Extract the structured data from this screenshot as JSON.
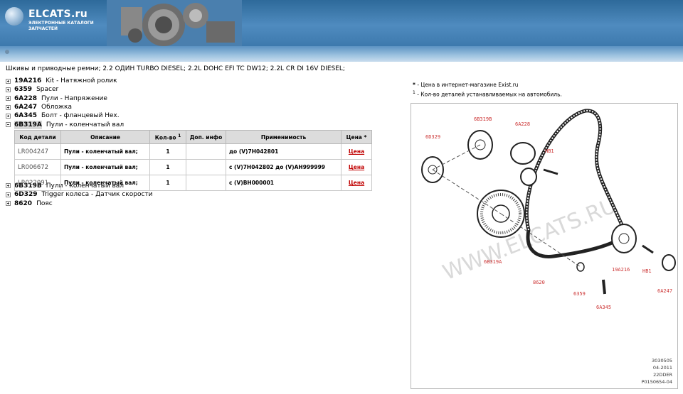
{
  "header": {
    "logo_text": "ELCATS.ru",
    "logo_sub1": "ЭЛЕКТРОННЫЕ КАТАЛОГИ",
    "logo_sub2": "ЗАПЧАСТЕЙ"
  },
  "page_title": "Шкивы и приводные ремни; 2.2 ОДИН TURBO DIESEL; 2.2L DOHC EFI TC DW12; 2.2L CR DI 16V DIESEL;",
  "tree": [
    {
      "code": "19A216",
      "label": "Kit - Натяжной ролик",
      "state": "collapsed"
    },
    {
      "code": "6359",
      "label": "Spacer",
      "state": "collapsed"
    },
    {
      "code": "6A228",
      "label": "Пули - Напряжение",
      "state": "collapsed"
    },
    {
      "code": "6A247",
      "label": "Обложка",
      "state": "collapsed"
    },
    {
      "code": "6A345",
      "label": "Болт - фланцевый Hex.",
      "state": "collapsed"
    },
    {
      "code": "6B319A",
      "label": "Пули - коленчатый вал",
      "state": "expanded"
    },
    {
      "code": "6B319B",
      "label": "Пули - коленчатый вал",
      "state": "collapsed"
    },
    {
      "code": "6D329",
      "label": "Trigger колеса - Датчик скорости",
      "state": "collapsed"
    },
    {
      "code": "8620",
      "label": "Пояс",
      "state": "collapsed"
    }
  ],
  "table": {
    "headers": {
      "part_no": "Код детали",
      "desc": "Описание",
      "qty": "Кол-во",
      "qty_sup": "1",
      "extra": "Доп. инфо",
      "applic": "Применимость",
      "price": "Цена *"
    },
    "rows": [
      {
        "part_no": "LR004247",
        "desc": "Пули - коленчатый вал;",
        "qty": "1",
        "extra": "",
        "applic": "до (V)7H042801",
        "price": "Цена"
      },
      {
        "part_no": "LR006672",
        "desc": "Пули - коленчатый вал;",
        "qty": "1",
        "extra": "",
        "applic": "с (V)7H042802 до (V)AH999999",
        "price": "Цена"
      },
      {
        "part_no": "LR022091",
        "desc": "Пули - коленчатый вал;",
        "qty": "1",
        "extra": "",
        "applic": "с (V)BH000001",
        "price": "Цена"
      }
    ]
  },
  "notes": {
    "price_mark": "*",
    "price_note": " - Цена в интернет-магазине Exist.ru",
    "qty_mark": "1",
    "qty_note": " - Кол-во деталей устанавливаемых на автомобиль."
  },
  "diagram": {
    "callouts": [
      "6B319B",
      "6A228",
      "6D329",
      "HB1",
      "6B319A",
      "19A216",
      "HB1",
      "8620",
      "6359",
      "6A247",
      "6A345"
    ],
    "watermark": "WWW.ELCATS.RU",
    "stamp": [
      "3030505",
      "04-2011",
      "22DDER",
      "P0150654-04"
    ]
  },
  "colors": {
    "callout": "#cc3333",
    "price_link": "#c00000",
    "banner": "#3d79ad"
  }
}
